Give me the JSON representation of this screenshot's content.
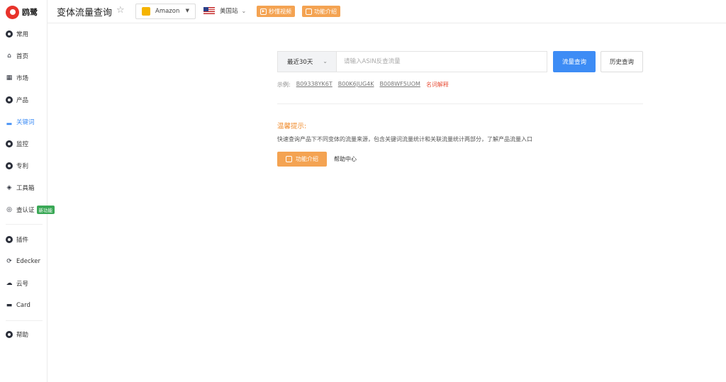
{
  "app": {
    "logo_text": "鸥鹭"
  },
  "sidebar": {
    "items": [
      {
        "label": "常用"
      },
      {
        "label": "首页"
      },
      {
        "label": "市场"
      },
      {
        "label": "产品"
      },
      {
        "label": "关键词"
      },
      {
        "label": "监控"
      },
      {
        "label": "专利"
      },
      {
        "label": "工具箱"
      },
      {
        "label": "查认证",
        "badge": "新功能"
      },
      {
        "label": "插件"
      },
      {
        "label": "Edecker"
      },
      {
        "label": "云号"
      },
      {
        "label": "Card"
      },
      {
        "label": "帮助"
      }
    ],
    "active_index": 4
  },
  "header": {
    "title": "变体流量查询",
    "platform": "Amazon",
    "site": "美国站",
    "video_btn": "秒懂视频",
    "intro_btn": "功能介绍"
  },
  "search": {
    "range": "最近30天",
    "placeholder": "请输入ASIN反查流量",
    "query_btn": "流量查询",
    "history_btn": "历史查询"
  },
  "examples": {
    "label": "示例:",
    "items": [
      "B09338YK6T",
      "B00K6JUG4K",
      "B008WF5UOM"
    ],
    "explain": "名词解释"
  },
  "tips": {
    "title": "温馨提示:",
    "text": "快速查询产品下不同变体的流量来源，包含关键词流量统计和关联流量统计两部分，了解产品流量入口",
    "intro_btn": "功能介绍",
    "help_link": "帮助中心"
  },
  "colors": {
    "primary": "#3d8cf5",
    "accent": "#f4a352",
    "brand": "#e8332b"
  }
}
